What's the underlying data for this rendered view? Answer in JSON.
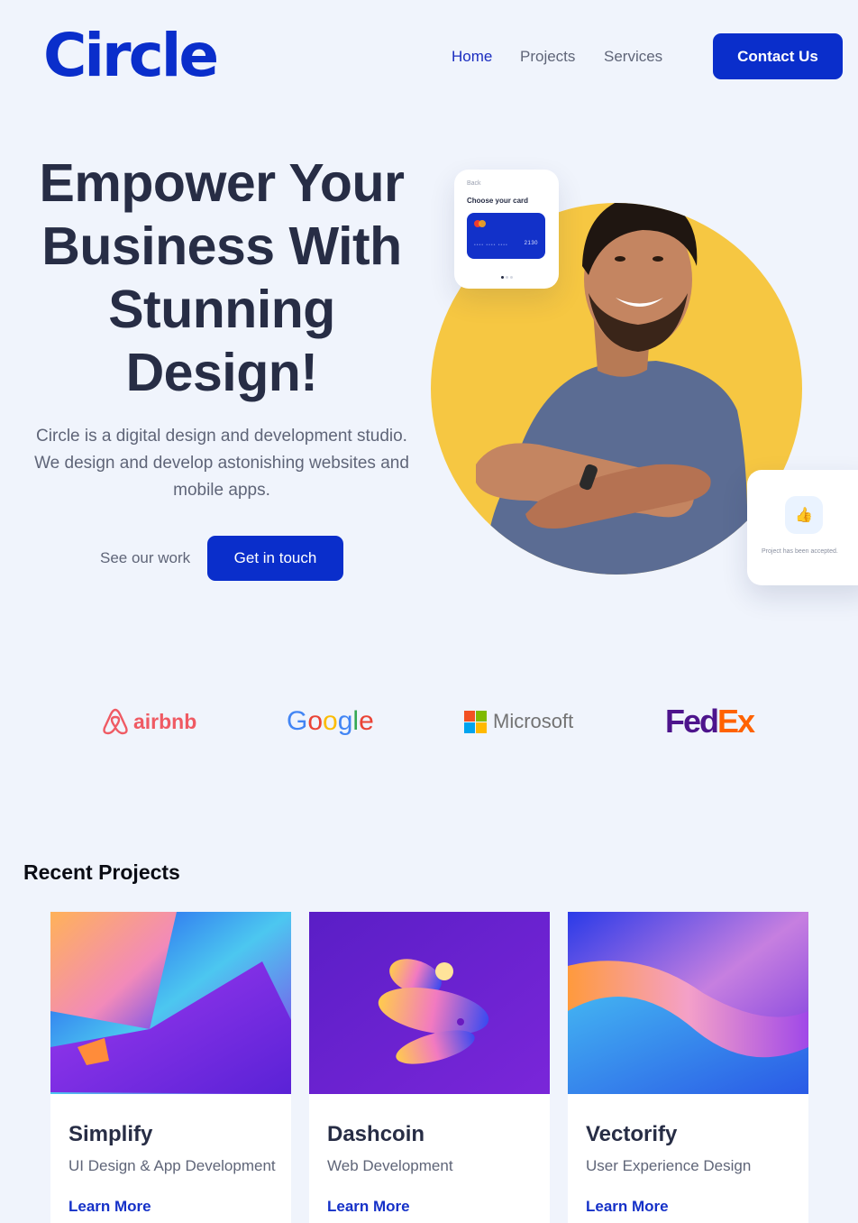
{
  "header": {
    "logo": "Circle",
    "nav": [
      {
        "label": "Home"
      },
      {
        "label": "Projects"
      },
      {
        "label": "Services"
      }
    ],
    "contact_label": "Contact Us"
  },
  "hero": {
    "title": "Empower Your Business With Stunning Design!",
    "description": "Circle is a digital design and development studio. We design and develop astonishing websites and mobile apps.",
    "see_work_label": "See our work",
    "get_in_touch_label": "Get in touch",
    "card_popup": {
      "back": "Back",
      "choose": "Choose your card",
      "card_dots": "•••• •••• ••••",
      "card_last": "2130"
    },
    "accept_popup": {
      "icon": "thumbs-up-icon",
      "message": "Project has been accepted."
    }
  },
  "brands": {
    "airbnb": "airbnb",
    "google_letters": [
      "G",
      "o",
      "o",
      "g",
      "l",
      "e"
    ],
    "google_colors": [
      "#4285F4",
      "#EA4335",
      "#FBBC05",
      "#4285F4",
      "#34A853",
      "#EA4335"
    ],
    "microsoft": "Microsoft",
    "microsoft_colors": [
      "#F25022",
      "#7FBA00",
      "#00A4EF",
      "#FFB900"
    ],
    "fedex_fed": "Fed",
    "fedex_ex": "Ex"
  },
  "projects": {
    "title": "Recent Projects",
    "items": [
      {
        "name": "Simplify",
        "category": "UI Design & App Development",
        "link": "Learn More"
      },
      {
        "name": "Dashcoin",
        "category": "Web Development",
        "link": "Learn More"
      },
      {
        "name": "Vectorify",
        "category": "User Experience Design",
        "link": "Learn More"
      }
    ]
  },
  "colors": {
    "accent": "#0a2ecb",
    "background": "#f0f4fc",
    "circle": "#f6c742"
  }
}
